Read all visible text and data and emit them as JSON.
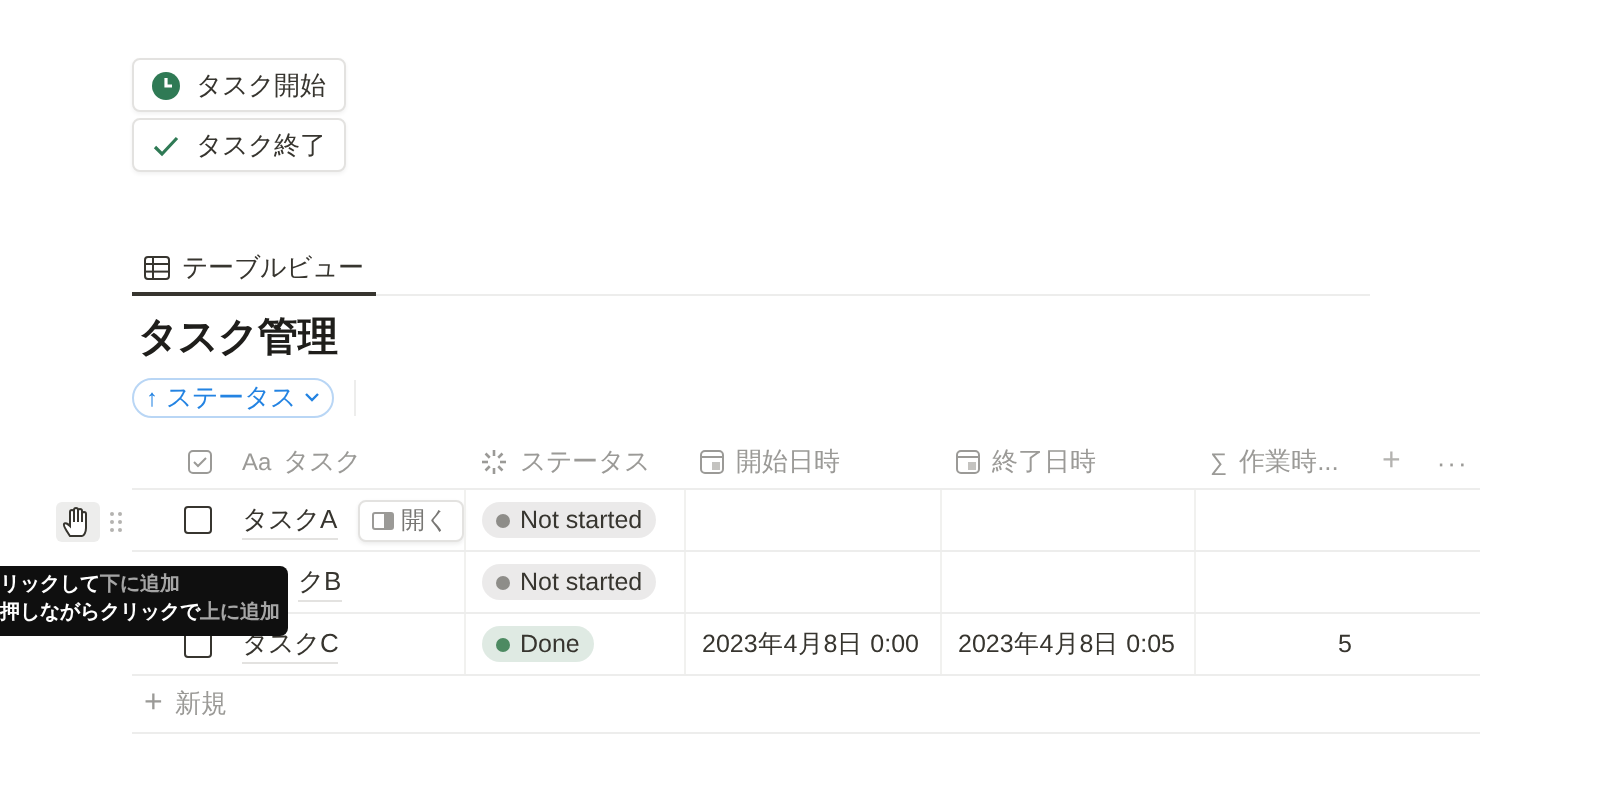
{
  "action_buttons": [
    {
      "kind": "clock",
      "label": "タスク開始"
    },
    {
      "kind": "check",
      "label": "タスク終了"
    }
  ],
  "tabs": [
    {
      "label": "テーブルビュー",
      "selected": true
    }
  ],
  "title": "タスク管理",
  "sort_chip": {
    "arrow": "↑",
    "label": "ステータス"
  },
  "table": {
    "columns": [
      {
        "kind": "checkbox"
      },
      {
        "icon_text": "Aa",
        "label": "タスク"
      },
      {
        "kind": "status",
        "label": "ステータス"
      },
      {
        "kind": "calendar",
        "label": "開始日時"
      },
      {
        "kind": "calendar",
        "label": "終了日時"
      },
      {
        "icon_text": "∑",
        "label": "作業時..."
      }
    ],
    "add_column": "+",
    "more": "···",
    "rows": [
      {
        "checked": false,
        "task": "タスクA",
        "open_button": "開く",
        "hovered": true,
        "status": {
          "label": "Not started",
          "color": "#8e8d89"
        },
        "start": "",
        "end": "",
        "hours": ""
      },
      {
        "task": "クB",
        "status": {
          "label": "Not started",
          "color": "#8e8d89"
        },
        "start": "",
        "end": "",
        "hours": ""
      },
      {
        "checked": false,
        "task": "タスクC",
        "status": {
          "label": "Done",
          "color": "#4d8a62"
        },
        "start": "2023年4月8日 0:00",
        "end": "2023年4月8日 0:05",
        "hours": "5"
      }
    ],
    "new_row": {
      "icon": "+",
      "label": "新規"
    }
  },
  "tooltip": {
    "lines": [
      [
        {
          "text": "リックして",
          "dim": false
        },
        {
          "text": "下に追加",
          "dim": true
        }
      ],
      [
        {
          "text": "押しながらクリックで",
          "dim": false
        },
        {
          "text": "上に追加",
          "dim": true
        }
      ]
    ]
  }
}
